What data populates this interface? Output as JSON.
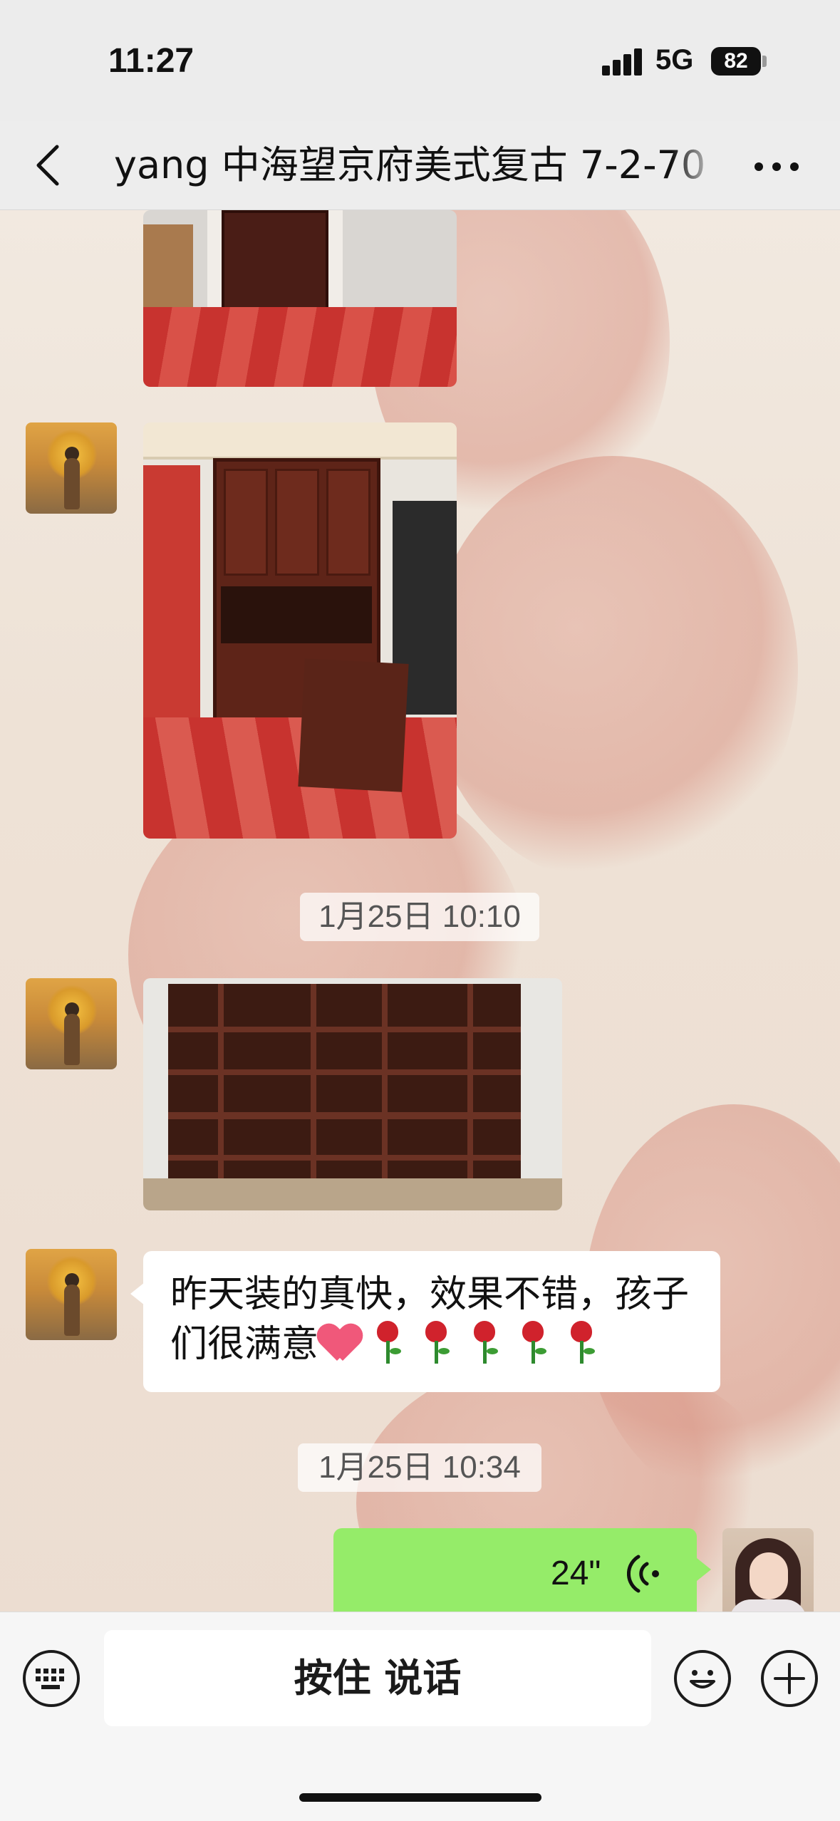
{
  "status_bar": {
    "time": "11:27",
    "network": "5G",
    "battery": "82"
  },
  "nav": {
    "title": "yang 中海望京府美式复古 7-2-70"
  },
  "messages": {
    "timestamp_1": "1月25日 10:10",
    "text_message": "昨天装的真快，效果不错，孩子们很满意",
    "timestamp_2": "1月25日 10:34",
    "voice_duration": "24\""
  },
  "input_bar": {
    "hold_to_talk": "按住 说话"
  },
  "colors": {
    "voice_bubble": "#95ec69",
    "text_bubble": "#ffffff",
    "bar_background": "#ededed"
  },
  "icons": [
    "back-icon",
    "more-icon",
    "voice-wave-icon",
    "keyboard-icon",
    "emoji-icon",
    "plus-icon",
    "signal-icon",
    "battery-icon"
  ]
}
